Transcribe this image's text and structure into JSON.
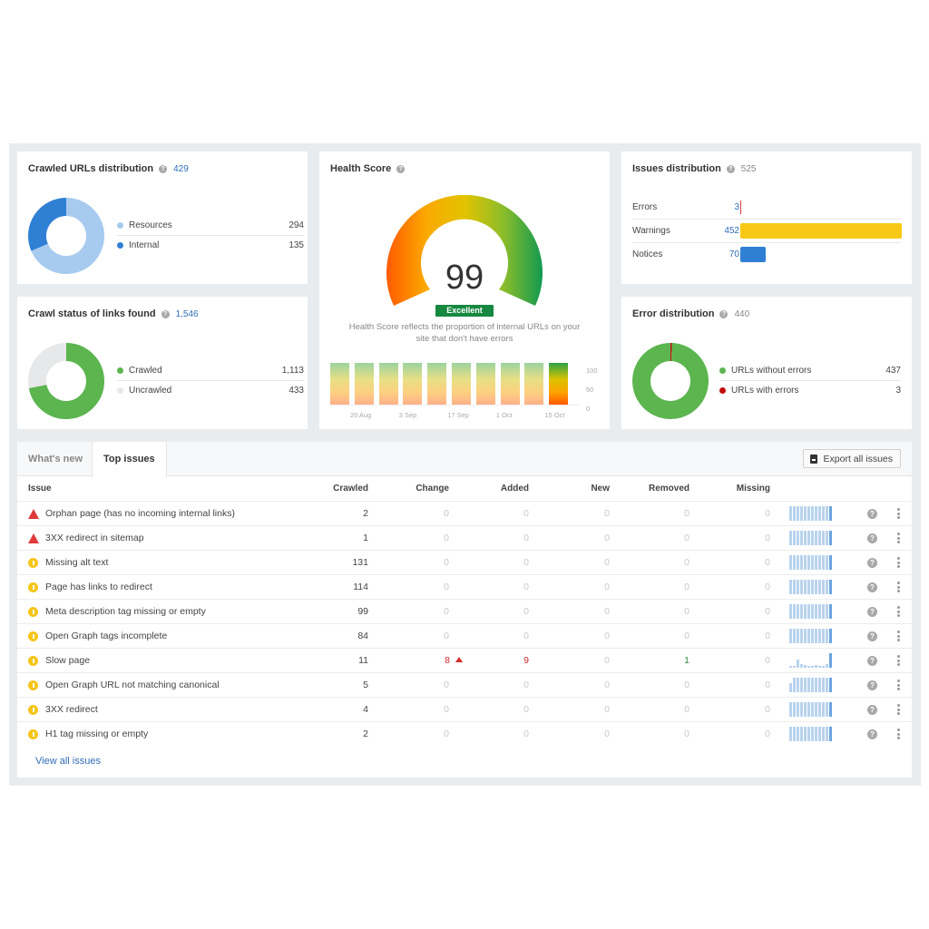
{
  "crawled_urls": {
    "title": "Crawled URLs distribution",
    "total": "429",
    "items": [
      {
        "label": "Resources",
        "value": "294",
        "color": "#a7cbef"
      },
      {
        "label": "Internal",
        "value": "135",
        "color": "#2f80d4"
      }
    ]
  },
  "crawl_status": {
    "title": "Crawl status of links found",
    "total": "1,546",
    "items": [
      {
        "label": "Crawled",
        "value": "1,113",
        "color": "#5cb54f"
      },
      {
        "label": "Uncrawled",
        "value": "433",
        "color": "#e6e8ea"
      }
    ]
  },
  "health": {
    "title": "Health Score",
    "score": "99",
    "score_value": 99,
    "badge": "Excellent",
    "badge_color": "#17883f",
    "description_line1": "Health Score reflects the proportion of internal URLs on your",
    "description_line2": "site that don't have errors",
    "history": {
      "x_labels": [
        "20 Aug",
        "3 Sep",
        "17 Sep",
        "1 Oct",
        "15 Oct"
      ],
      "y_labels": [
        "100",
        "50",
        "0"
      ],
      "bar_count": 10
    }
  },
  "issues_distribution": {
    "title": "Issues distribution",
    "total": "525",
    "items": [
      {
        "label": "Errors",
        "value": "3",
        "num": 3,
        "color": "#d04040"
      },
      {
        "label": "Warnings",
        "value": "452",
        "num": 452,
        "color": "#f8c914"
      },
      {
        "label": "Notices",
        "value": "70",
        "num": 70,
        "color": "#2f80d4"
      }
    ]
  },
  "error_distribution": {
    "title": "Error distribution",
    "total": "440",
    "items": [
      {
        "label": "URLs without errors",
        "value": "437",
        "color": "#5cb54f"
      },
      {
        "label": "URLs with errors",
        "value": "3",
        "color": "#c00d0d"
      }
    ]
  },
  "issues_table": {
    "tabs": [
      "What's new",
      "Top issues"
    ],
    "active_tab": "Top issues",
    "export_label": "Export all issues",
    "columns": [
      "Issue",
      "Crawled",
      "Change",
      "Added",
      "New",
      "Removed",
      "Missing"
    ],
    "rows": [
      {
        "type": "error",
        "issue": "Orphan page (has no incoming internal links)",
        "crawled": "2",
        "change": "0",
        "added": "0",
        "new": "0",
        "removed": "0",
        "missing": "0",
        "trend": "flat"
      },
      {
        "type": "error",
        "issue": "3XX redirect in sitemap",
        "crawled": "1",
        "change": "0",
        "added": "0",
        "new": "0",
        "removed": "0",
        "missing": "0",
        "trend": "flat"
      },
      {
        "type": "warning",
        "issue": "Missing alt text",
        "crawled": "131",
        "change": "0",
        "added": "0",
        "new": "0",
        "removed": "0",
        "missing": "0",
        "trend": "flat"
      },
      {
        "type": "warning",
        "issue": "Page has links to redirect",
        "crawled": "114",
        "change": "0",
        "added": "0",
        "new": "0",
        "removed": "0",
        "missing": "0",
        "trend": "flat"
      },
      {
        "type": "warning",
        "issue": "Meta description tag missing or empty",
        "crawled": "99",
        "change": "0",
        "added": "0",
        "new": "0",
        "removed": "0",
        "missing": "0",
        "trend": "flat"
      },
      {
        "type": "warning",
        "issue": "Open Graph tags incomplete",
        "crawled": "84",
        "change": "0",
        "added": "0",
        "new": "0",
        "removed": "0",
        "missing": "0",
        "trend": "flat"
      },
      {
        "type": "warning",
        "issue": "Slow page",
        "crawled": "11",
        "change": "8",
        "change_dir": "up",
        "added": "9",
        "new": "0",
        "removed": "1",
        "missing": "0",
        "trend": "spiky"
      },
      {
        "type": "warning",
        "issue": "Open Graph URL not matching canonical",
        "crawled": "5",
        "change": "0",
        "added": "0",
        "new": "0",
        "removed": "0",
        "missing": "0",
        "trend": "step"
      },
      {
        "type": "warning",
        "issue": "3XX redirect",
        "crawled": "4",
        "change": "0",
        "added": "0",
        "new": "0",
        "removed": "0",
        "missing": "0",
        "trend": "flat"
      },
      {
        "type": "warning",
        "issue": "H1 tag missing or empty",
        "crawled": "2",
        "change": "0",
        "added": "0",
        "new": "0",
        "removed": "0",
        "missing": "0",
        "trend": "flat"
      }
    ],
    "view_all_label": "View all issues"
  },
  "icons": {
    "help": "question-circle-icon",
    "error": "warning-triangle-icon",
    "warning": "info-circle-icon",
    "export": "file-icon",
    "row_help": "question-circle-icon",
    "row_menu": "kebab-menu-icon"
  }
}
